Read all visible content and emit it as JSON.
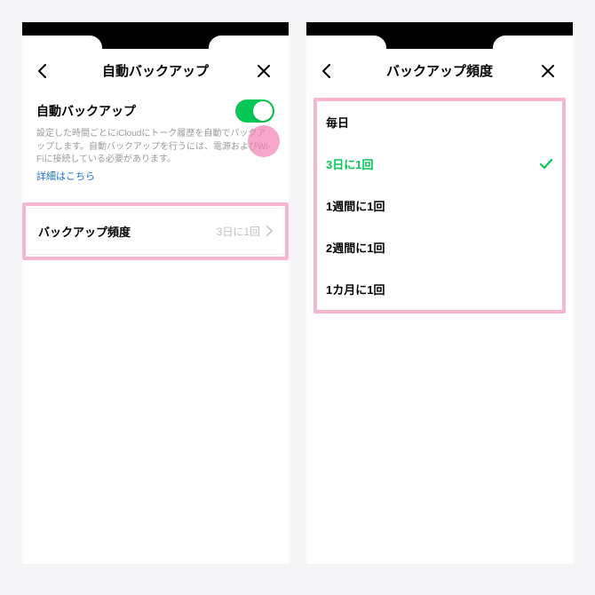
{
  "accent_green": "#06C755",
  "highlight_pink": "#f6b6cf",
  "left": {
    "header": {
      "title": "自動バックアップ"
    },
    "toggle": {
      "label": "自動バックアップ",
      "on": true
    },
    "description": "設定した時間ごとにiCloudにトーク履歴を自動でバックアップします。自動バックアップを行うには、電源およびWi-Fiに接続している必要があります。",
    "link": "詳細はこちら",
    "frequency": {
      "label": "バックアップ頻度",
      "value": "3日に1回"
    }
  },
  "right": {
    "header": {
      "title": "バックアップ頻度"
    },
    "options": [
      {
        "label": "毎日",
        "selected": false
      },
      {
        "label": "3日に1回",
        "selected": true
      },
      {
        "label": "1週間に1回",
        "selected": false
      },
      {
        "label": "2週間に1回",
        "selected": false
      },
      {
        "label": "1カ月に1回",
        "selected": false
      }
    ]
  }
}
